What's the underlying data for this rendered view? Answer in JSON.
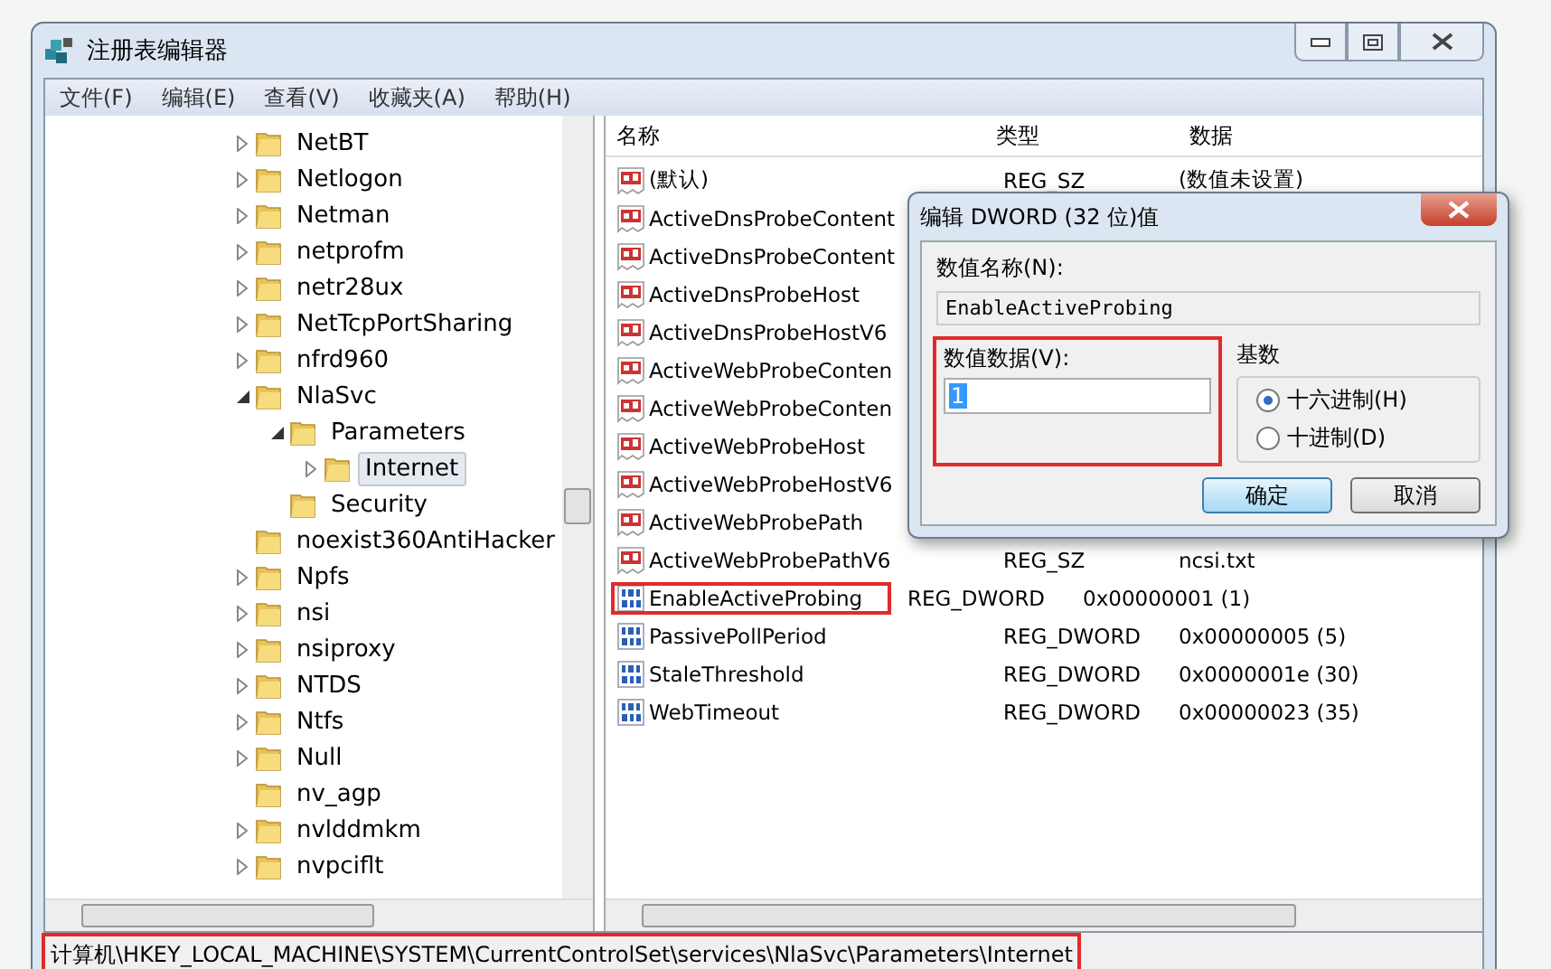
{
  "window": {
    "title": "注册表编辑器"
  },
  "menu": [
    "文件(F)",
    "编辑(E)",
    "查看(V)",
    "收藏夹(A)",
    "帮助(H)"
  ],
  "tree": [
    {
      "label": "NetBT",
      "kind": "branch",
      "expanded": false,
      "selected": false
    },
    {
      "label": "Netlogon",
      "kind": "branch",
      "expanded": false,
      "selected": false
    },
    {
      "label": "Netman",
      "kind": "branch",
      "expanded": false,
      "selected": false
    },
    {
      "label": "netprofm",
      "kind": "branch",
      "expanded": false,
      "selected": false
    },
    {
      "label": "netr28ux",
      "kind": "branch",
      "expanded": false,
      "selected": false
    },
    {
      "label": "NetTcpPortSharing",
      "kind": "branch",
      "expanded": false,
      "selected": false
    },
    {
      "label": "nfrd960",
      "kind": "branch",
      "expanded": false,
      "selected": false
    },
    {
      "label": "NlaSvc",
      "kind": "branch",
      "expanded": true,
      "selected": false,
      "children": [
        {
          "label": "Parameters",
          "kind": "branch",
          "expanded": true,
          "selected": false,
          "children": [
            {
              "label": "Internet",
              "kind": "branch",
              "expanded": false,
              "selected": true
            }
          ]
        },
        {
          "label": "Security",
          "kind": "leaf",
          "selected": false
        }
      ]
    },
    {
      "label": "noexist360AntiHacker",
      "kind": "leaf",
      "selected": false
    },
    {
      "label": "Npfs",
      "kind": "branch",
      "expanded": false,
      "selected": false
    },
    {
      "label": "nsi",
      "kind": "branch",
      "expanded": false,
      "selected": false
    },
    {
      "label": "nsiproxy",
      "kind": "branch",
      "expanded": false,
      "selected": false
    },
    {
      "label": "NTDS",
      "kind": "branch",
      "expanded": false,
      "selected": false
    },
    {
      "label": "Ntfs",
      "kind": "branch",
      "expanded": false,
      "selected": false
    },
    {
      "label": "Null",
      "kind": "branch",
      "expanded": false,
      "selected": false
    },
    {
      "label": "nv_agp",
      "kind": "leaf",
      "selected": false
    },
    {
      "label": "nvlddmkm",
      "kind": "branch",
      "expanded": false,
      "selected": false
    },
    {
      "label": "nvpciflt",
      "kind": "branch",
      "expanded": false,
      "selected": false
    }
  ],
  "table": {
    "columns": [
      "名称",
      "类型",
      "数据"
    ],
    "rows": [
      {
        "name": "(默认)",
        "kind": "string",
        "type": "REG_SZ",
        "data": "(数值未设置)",
        "highlighted": false
      },
      {
        "name": "ActiveDnsProbeContent",
        "kind": "string",
        "highlighted": false
      },
      {
        "name": "ActiveDnsProbeContent",
        "kind": "string",
        "highlighted": false
      },
      {
        "name": "ActiveDnsProbeHost",
        "kind": "string",
        "highlighted": false
      },
      {
        "name": "ActiveDnsProbeHostV6",
        "kind": "string",
        "highlighted": false
      },
      {
        "name": "ActiveWebProbeConten",
        "kind": "string",
        "highlighted": false
      },
      {
        "name": "ActiveWebProbeConten",
        "kind": "string",
        "highlighted": false
      },
      {
        "name": "ActiveWebProbeHost",
        "kind": "string",
        "highlighted": false
      },
      {
        "name": "ActiveWebProbeHostV6",
        "kind": "string",
        "highlighted": false
      },
      {
        "name": "ActiveWebProbePath",
        "kind": "string",
        "highlighted": false
      },
      {
        "name": "ActiveWebProbePathV6",
        "kind": "string",
        "type": "REG_SZ",
        "data": "ncsi.txt",
        "highlighted": false
      },
      {
        "name": "EnableActiveProbing",
        "kind": "dword",
        "type": "REG_DWORD",
        "data": "0x00000001 (1)",
        "highlighted": true
      },
      {
        "name": "PassivePollPeriod",
        "kind": "dword",
        "type": "REG_DWORD",
        "data": "0x00000005 (5)",
        "highlighted": false
      },
      {
        "name": "StaleThreshold",
        "kind": "dword",
        "type": "REG_DWORD",
        "data": "0x0000001e (30)",
        "highlighted": false
      },
      {
        "name": "WebTimeout",
        "kind": "dword",
        "type": "REG_DWORD",
        "data": "0x00000023 (35)",
        "highlighted": false
      }
    ]
  },
  "status_bar": {
    "path": "计算机\\HKEY_LOCAL_MACHINE\\SYSTEM\\CurrentControlSet\\services\\NlaSvc\\Parameters\\Internet",
    "highlighted": true
  },
  "dialog": {
    "title": "编辑 DWORD (32 位)值",
    "name_label": "数值名称(N):",
    "name_value": "EnableActiveProbing",
    "data_label": "数值数据(V):",
    "data_value": "1",
    "data_highlighted": true,
    "base_label": "基数",
    "radios": [
      {
        "label": "十六进制(H)",
        "selected": true
      },
      {
        "label": "十进制(D)",
        "selected": false
      }
    ],
    "buttons": [
      {
        "label": "确定",
        "default": true
      },
      {
        "label": "取消",
        "default": false
      }
    ]
  }
}
